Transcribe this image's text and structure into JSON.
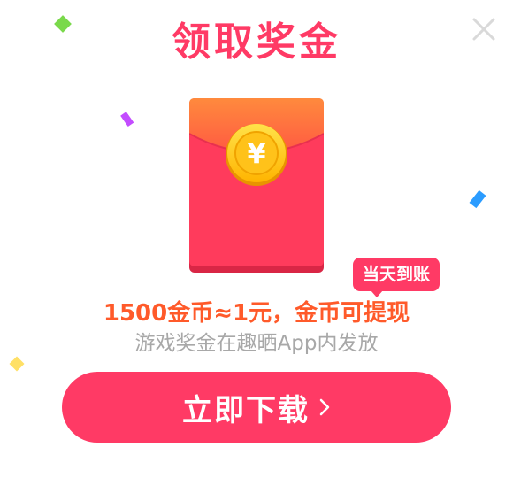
{
  "dialog": {
    "title": "领取奖金",
    "badge": "当天到账",
    "reward_text": "1500金币≈1元，金币可提现",
    "sub_text": "游戏奖金在趣晒App内发放",
    "download_label": "立即下载",
    "envelope_symbol": "¥"
  },
  "icons": {
    "close": "close-icon",
    "chevron": "chevron-right-icon",
    "coin": "yuan-coin-icon"
  },
  "colors": {
    "title": "#ff3a65",
    "accent": "#ff3a65",
    "reward_text": "#ff5a2a",
    "sub_text": "#a8a8a8",
    "close": "#d9d9d9",
    "envelope_top": "#ff7a40",
    "envelope_body": "#ff3b5c",
    "coin": "#ffc21a",
    "confetti_green": "#7ad94b",
    "confetti_purple": "#c34cff",
    "confetti_blue": "#2b9cff",
    "confetti_yellow": "#ffe066"
  }
}
